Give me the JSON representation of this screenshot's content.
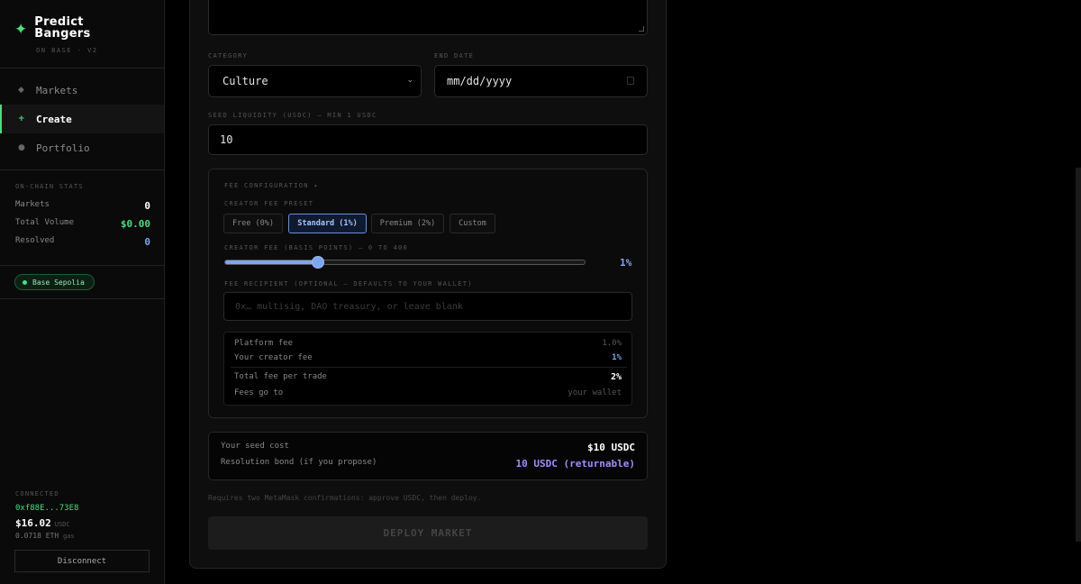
{
  "brand": {
    "title": "Predict\nBangers",
    "subtitle": "ON BASE · V2"
  },
  "nav": [
    {
      "label": "Markets",
      "icon": "diamond-icon",
      "glyph": "◆"
    },
    {
      "label": "Create",
      "icon": "plus-icon",
      "glyph": "+"
    },
    {
      "label": "Portfolio",
      "icon": "circle-icon",
      "glyph": "●"
    }
  ],
  "stats": {
    "title": "ON-CHAIN STATS",
    "rows": [
      {
        "label": "Markets",
        "value": "0",
        "color": "#ffffff"
      },
      {
        "label": "Total Volume",
        "value": "$0.00",
        "color": "#4ade80"
      },
      {
        "label": "Resolved",
        "value": "0",
        "color": "#7ea6f0"
      }
    ]
  },
  "network": {
    "label": "Base Sepolia"
  },
  "wallet": {
    "connected_label": "CONNECTED",
    "address": "0xf88E...73E8",
    "balance": "$16.02",
    "balance_unit": "USDC",
    "gas": "0.0718 ETH",
    "gas_unit": "gas",
    "disconnect_label": "Disconnect"
  },
  "form": {
    "category_label": "CATEGORY",
    "category_value": "Culture",
    "end_date_label": "END DATE",
    "end_date_placeholder": "mm/dd/yyyy",
    "seed_label": "SEED LIQUIDITY (USDC) — MIN 1 USDC",
    "seed_value": "10",
    "fee_config_label": "FEE CONFIGURATION ✦",
    "preset_label": "CREATOR FEE PRESET",
    "presets": [
      "Free (0%)",
      "Standard (1%)",
      "Premium (2%)",
      "Custom"
    ],
    "active_preset": 1,
    "creator_fee_label": "CREATOR FEE (BASIS POINTS) — 0 TO 400",
    "creator_fee_bps": 100,
    "creator_fee_max_bps": 400,
    "creator_fee_display": "1%",
    "recipient_label": "FEE RECIPIENT (OPTIONAL — DEFAULTS TO YOUR WALLET)",
    "recipient_placeholder": "0x… multisig, DAO treasury, or leave blank",
    "summary": {
      "platform_fee_label": "Platform fee",
      "platform_fee_value": "1.0%",
      "creator_fee_label": "Your creator fee",
      "creator_fee_value": "1%",
      "total_fee_label": "Total fee per trade",
      "total_fee_value": "2%",
      "fees_go_label": "Fees go to",
      "fees_go_value": "your wallet"
    },
    "seed_cost_label": "Your seed cost",
    "seed_cost_value": "$10 USDC",
    "bond_label": "Resolution bond (if you propose)",
    "bond_value": "10 USDC (returnable)",
    "note": "Requires two MetaMask confirmations: approve USDC, then deploy.",
    "deploy_label": "DEPLOY MARKET"
  },
  "colors": {
    "accent_green": "#4ade80",
    "accent_blue": "#7ea6f0",
    "accent_purple": "#a78bfa"
  }
}
